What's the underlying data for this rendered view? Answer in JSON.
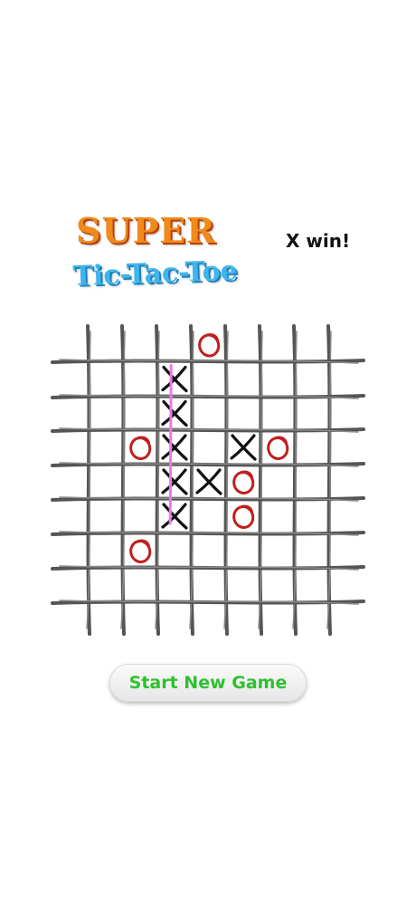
{
  "app": {
    "title_line1": "SUPER",
    "title_line2": "Tic-Tac-Toe"
  },
  "status": {
    "text": "X win!"
  },
  "board": {
    "rows": 8,
    "cols": 8,
    "line_color": "#555555",
    "x_color": "#111111",
    "o_color": "#c0201e",
    "win_line_color": "#e879e8",
    "marks": [
      {
        "row": 0,
        "col": 4,
        "mark": "O"
      },
      {
        "row": 1,
        "col": 3,
        "mark": "X"
      },
      {
        "row": 2,
        "col": 3,
        "mark": "X"
      },
      {
        "row": 3,
        "col": 2,
        "mark": "O"
      },
      {
        "row": 3,
        "col": 3,
        "mark": "X"
      },
      {
        "row": 3,
        "col": 5,
        "mark": "X"
      },
      {
        "row": 3,
        "col": 6,
        "mark": "O"
      },
      {
        "row": 4,
        "col": 3,
        "mark": "X"
      },
      {
        "row": 4,
        "col": 4,
        "mark": "X"
      },
      {
        "row": 4,
        "col": 5,
        "mark": "O"
      },
      {
        "row": 5,
        "col": 3,
        "mark": "X"
      },
      {
        "row": 5,
        "col": 5,
        "mark": "O"
      },
      {
        "row": 6,
        "col": 2,
        "mark": "O"
      }
    ],
    "winning_line": {
      "from": {
        "row": 1,
        "col": 3
      },
      "to": {
        "row": 5,
        "col": 3
      }
    }
  },
  "controls": {
    "new_game_label": "Start New Game"
  }
}
